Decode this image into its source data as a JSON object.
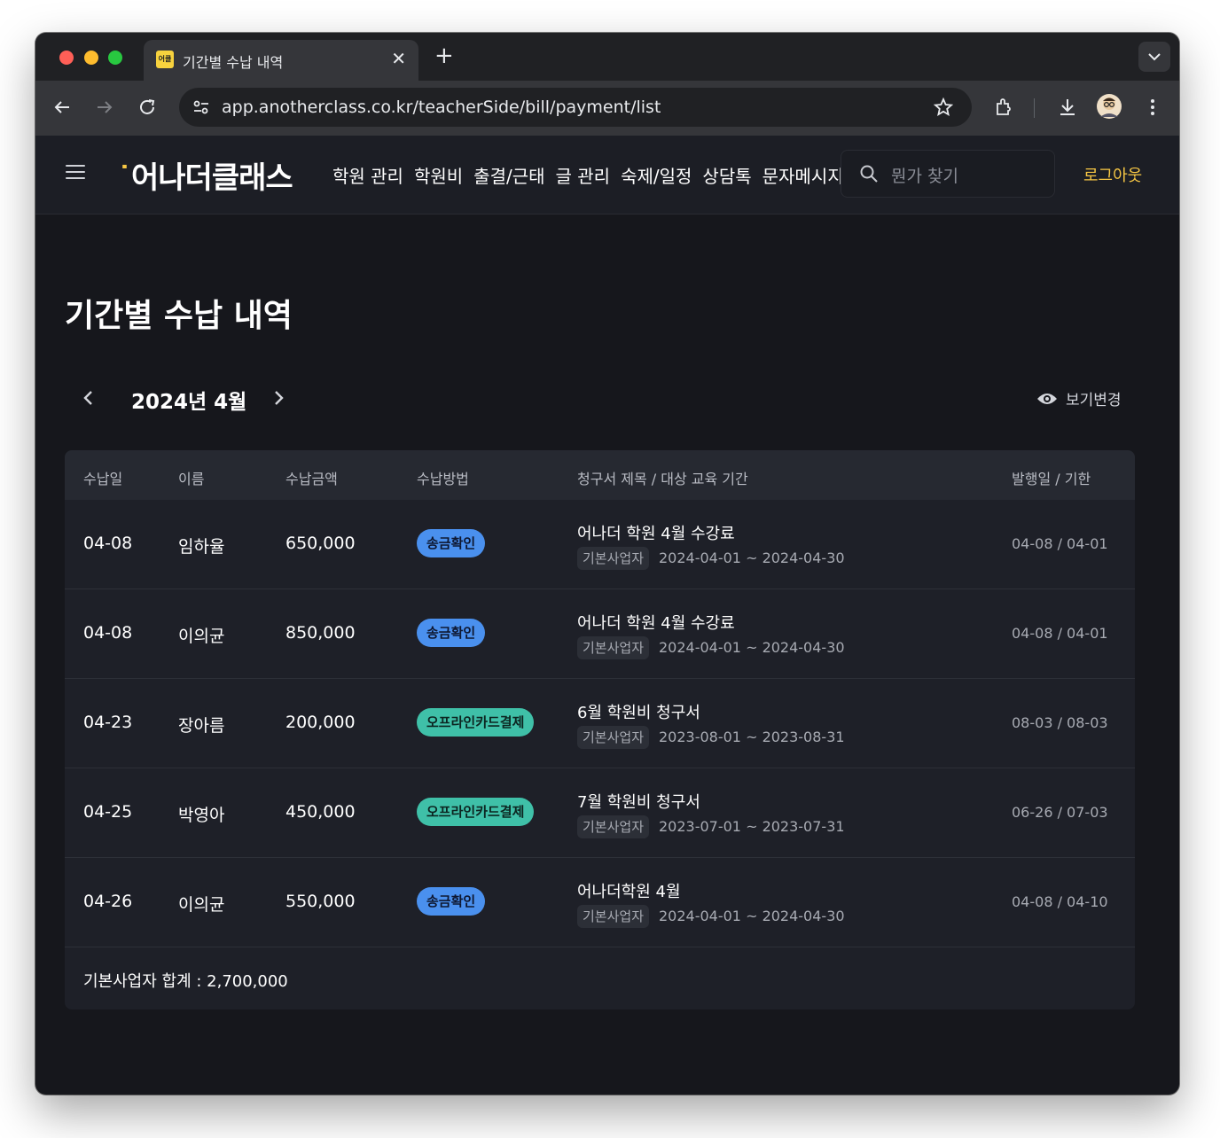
{
  "browser": {
    "tab_title": "기간별 수납 내역",
    "tab_favicon_text": "어클",
    "url": "app.anotherclass.co.kr/teacherSide/bill/payment/list"
  },
  "header": {
    "logo": "어나더클래스",
    "nav": [
      "학원 관리",
      "학원비",
      "출결/근태",
      "글 관리",
      "숙제/일정",
      "상담톡",
      "문자메시지"
    ],
    "search_placeholder": "뭔가 찾기",
    "logout": "로그아웃"
  },
  "page": {
    "title": "기간별 수납 내역",
    "month": "2024년 4월",
    "view_toggle": "보기변경"
  },
  "table": {
    "headers": {
      "date": "수납일",
      "name": "이름",
      "amount": "수납금액",
      "method": "수납방법",
      "bill": "청구서 제목 / 대상 교육 기간",
      "issue": "발행일 / 기한"
    },
    "rows": [
      {
        "date": "04-08",
        "name": "임하율",
        "amount": "650,000",
        "method": "송금확인",
        "method_type": "blue",
        "title": "어나더 학원 4월 수강료",
        "biz": "기본사업자",
        "period": "2024-04-01 ~ 2024-04-30",
        "issue": "04-08 / 04-01"
      },
      {
        "date": "04-08",
        "name": "이의균",
        "amount": "850,000",
        "method": "송금확인",
        "method_type": "blue",
        "title": "어나더 학원 4월 수강료",
        "biz": "기본사업자",
        "period": "2024-04-01 ~ 2024-04-30",
        "issue": "04-08 / 04-01"
      },
      {
        "date": "04-23",
        "name": "장아름",
        "amount": "200,000",
        "method": "오프라인카드결제",
        "method_type": "teal",
        "title": "6월 학원비 청구서",
        "biz": "기본사업자",
        "period": "2023-08-01 ~ 2023-08-31",
        "issue": "08-03 / 08-03"
      },
      {
        "date": "04-25",
        "name": "박영아",
        "amount": "450,000",
        "method": "오프라인카드결제",
        "method_type": "teal",
        "title": "7월 학원비 청구서",
        "biz": "기본사업자",
        "period": "2023-07-01 ~ 2023-07-31",
        "issue": "06-26 / 07-03"
      },
      {
        "date": "04-26",
        "name": "이의균",
        "amount": "550,000",
        "method": "송금확인",
        "method_type": "blue",
        "title": "어나더학원 4월",
        "biz": "기본사업자",
        "period": "2024-04-01 ~ 2024-04-30",
        "issue": "04-08 / 04-10"
      }
    ],
    "total": "기본사업자 합계 : 2,700,000"
  },
  "colors": {
    "accent_yellow": "#f7c744",
    "badge_blue": "#4a90ee",
    "badge_teal": "#3fc0a8",
    "background": "#16171c"
  },
  "icons": [
    "hamburger-icon",
    "search-icon",
    "eye-icon",
    "chevron-left-icon",
    "chevron-right-icon",
    "star-icon",
    "extension-icon",
    "download-icon",
    "more-icon"
  ]
}
